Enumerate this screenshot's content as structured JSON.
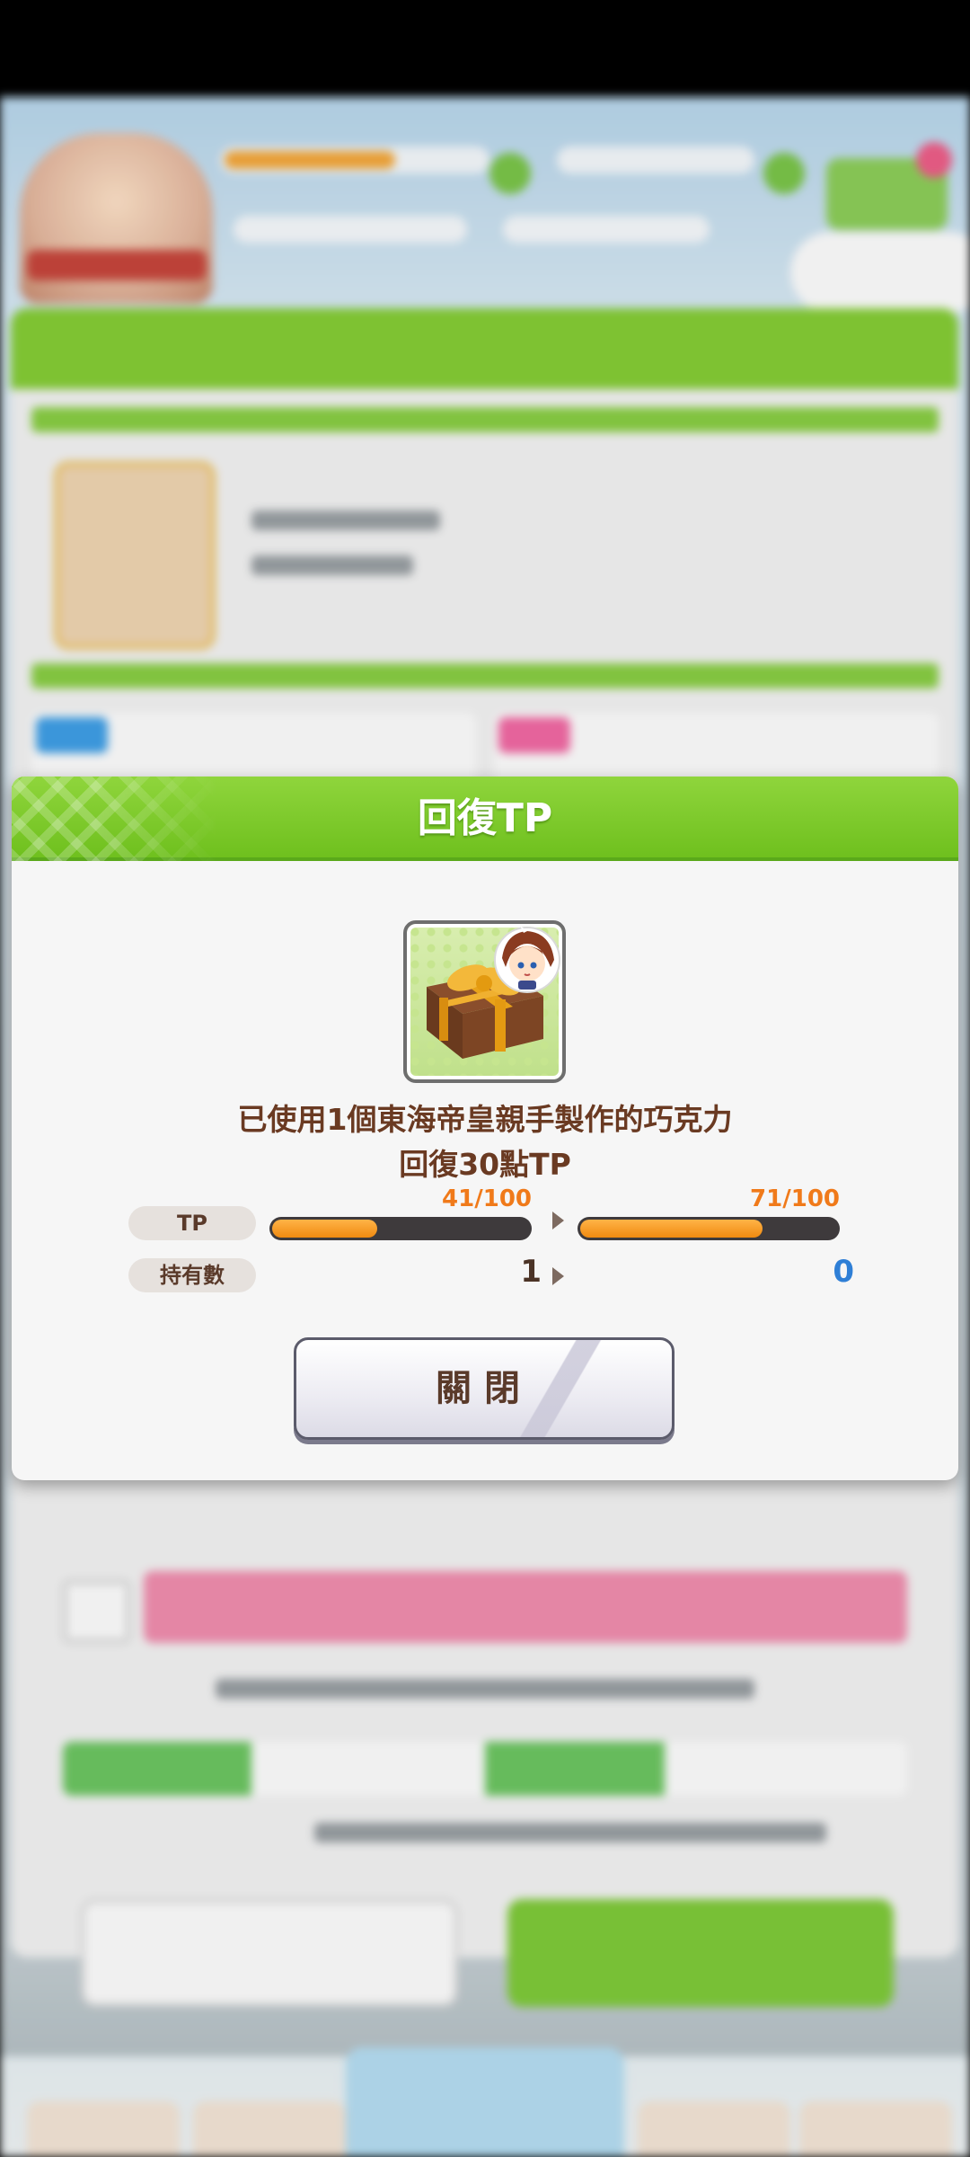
{
  "dialog": {
    "title": "回復TP",
    "message_line1": "已使用1個東海帝皇親手製作的巧克力",
    "message_line2": "回復30點TP",
    "item_icon": "chocolate-gift-box-with-character-icon",
    "tp": {
      "label": "TP",
      "before": "41/100",
      "after": "71/100",
      "before_fraction": 0.41,
      "after_fraction": 0.71
    },
    "owned": {
      "label": "持有數",
      "before": "1",
      "after": "0"
    },
    "close_label": "關閉"
  },
  "colors": {
    "header_green": "#7fcb2c",
    "message_brown": "#6a3a22",
    "tp_orange": "#f07a1a",
    "count_after_blue": "#2f7fd6"
  }
}
